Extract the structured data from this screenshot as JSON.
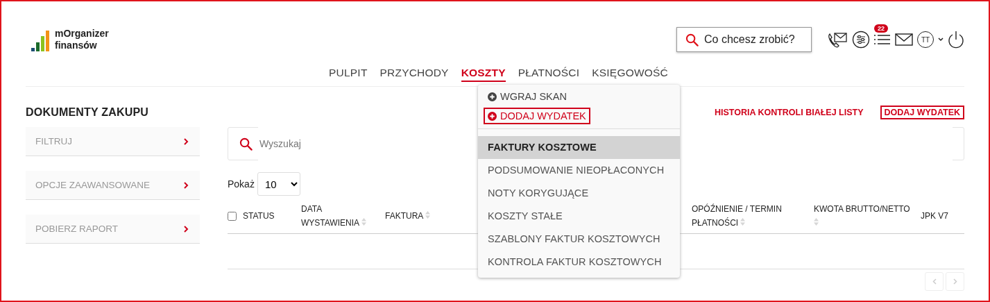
{
  "logo": {
    "line_1": "mOrganizer",
    "line_2": "finansów"
  },
  "quick_search": {
    "placeholder": "Co chcesz zrobić?"
  },
  "toolbar": {
    "notifications_badge": "22",
    "avatar": "TT"
  },
  "nav": [
    {
      "label": "PULPIT",
      "selected": false
    },
    {
      "label": "PRZYCHODY",
      "selected": false
    },
    {
      "label": "KOSZTY",
      "selected": true
    },
    {
      "label": "PŁATNOŚCI",
      "selected": false
    },
    {
      "label": "KSIĘGOWOŚĆ",
      "selected": false
    }
  ],
  "dropdown": {
    "actions": [
      {
        "label": "WGRAJ SKAN",
        "highlighted": false
      },
      {
        "label": "DODAJ WYDATEK",
        "highlighted": true
      }
    ],
    "items": [
      {
        "label": "FAKTURY KOSZTOWE",
        "selected": true
      },
      {
        "label": "PODSUMOWANIE NIEOPŁACONYCH",
        "selected": false
      },
      {
        "label": "NOTY KORYGUJĄCE",
        "selected": false
      },
      {
        "label": "KOSZTY STAŁE",
        "selected": false
      },
      {
        "label": "SZABLONY FAKTUR KOSZTOWYCH",
        "selected": false
      },
      {
        "label": "KONTROLA FAKTUR KOSZTOWYCH",
        "selected": false
      }
    ]
  },
  "page_title": "DOKUMENTY ZAKUPU",
  "header_links": [
    "HISTORIA KONTROLI BIAŁEJ LISTY"
  ],
  "add_button": "DODAJ WYDATEK",
  "sidebar": {
    "items": [
      "FILTRUJ",
      "OPCJE ZAAWANSOWANE",
      "POBIERZ RAPORT"
    ]
  },
  "search": {
    "placeholder": "Wyszukaj"
  },
  "page_size": {
    "label": "Pokaż",
    "value": "10"
  },
  "table": {
    "select_all_checked": false,
    "columns": [
      {
        "label": "STATUS",
        "sortable": false
      },
      {
        "label": "DATA WYSTAWIENIA",
        "sortable": true
      },
      {
        "label": "FAKTURA",
        "sortable": true
      },
      {
        "label": "OPÓŹNIENIE / TERMIN PŁATNOŚCI",
        "sortable": true
      },
      {
        "label": "KWOTA BRUTTO/NETTO",
        "sortable": true
      },
      {
        "label": "JPK V7",
        "sortable": false
      }
    ]
  }
}
